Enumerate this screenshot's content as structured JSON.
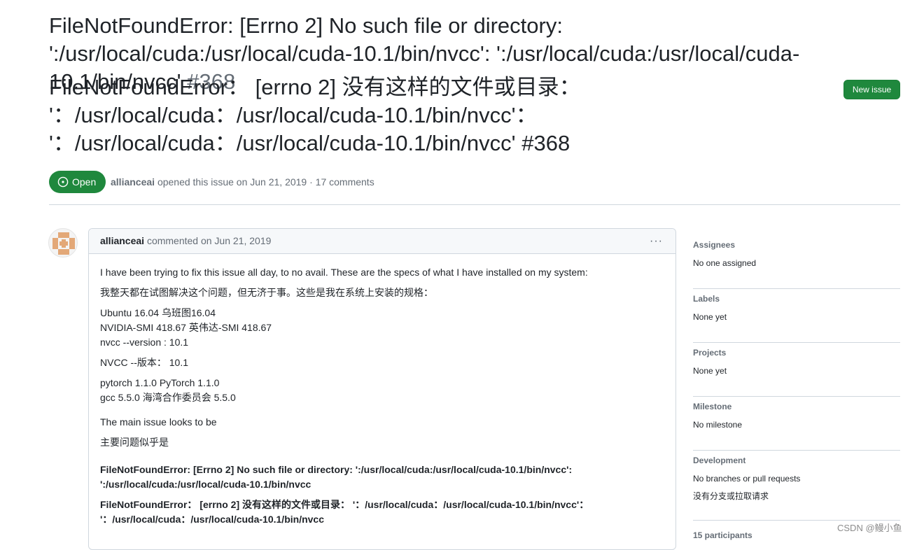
{
  "issue": {
    "title_en": "FileNotFoundError: [Errno 2] No such file or directory: ':/usr/local/cuda:/usr/local/cuda-10.1/bin/nvcc': ':/usr/local/cuda:/usr/local/cuda-10.1/bin/nvcc'",
    "title_zh": "FileNotFoundError： [errno 2] 没有这样的文件或目录： '：/usr/local/cuda：/usr/local/cuda-10.1/bin/nvcc'： '：/usr/local/cuda：/usr/local/cuda-10.1/bin/nvcc'",
    "number_en": "#368",
    "number_zh": "#368",
    "new_issue_label": "New issue",
    "state_label": "Open",
    "author": "allianceai",
    "meta_text": "opened this issue on Jun 21, 2019 · 17 comments"
  },
  "comment": {
    "author": "allianceai",
    "meta": "commented on Jun 21, 2019",
    "menu_label": "···",
    "lines": {
      "l1": "I have been trying to fix this issue all day, to no avail. These are the specs of what I have installed on my system:",
      "l2": "我整天都在试图解决这个问题，但无济于事。这些是我在系统上安装的规格：",
      "l3": "Ubuntu 16.04 乌班图16.04",
      "l4": "NVIDIA-SMI 418.67 英伟达-SMI 418.67",
      "l5": "nvcc --version : 10.1",
      "l6": "NVCC --版本： 10.1",
      "l7": "pytorch 1.1.0 PyTorch 1.1.0",
      "l8": "gcc 5.5.0 海湾合作委员会 5.5.0",
      "l9": "The main issue looks to be",
      "l10": "主要问题似乎是",
      "l11": "FileNotFoundError: [Errno 2] No such file or directory: ':/usr/local/cuda:/usr/local/cuda-10.1/bin/nvcc': ':/usr/local/cuda:/usr/local/cuda-10.1/bin/nvcc",
      "l12": "FileNotFoundError： [errno 2] 没有这样的文件或目录： '：/usr/local/cuda：/usr/local/cuda-10.1/bin/nvcc'： '：/usr/local/cuda：/usr/local/cuda-10.1/bin/nvcc"
    }
  },
  "sidebar": {
    "assignees": {
      "title": "Assignees",
      "value": "No one assigned"
    },
    "labels": {
      "title": "Labels",
      "value": "None yet"
    },
    "projects": {
      "title": "Projects",
      "value": "None yet"
    },
    "milestone": {
      "title": "Milestone",
      "value": "No milestone"
    },
    "development": {
      "title": "Development",
      "value": "No branches or pull requests",
      "value_zh": "没有分支或拉取请求"
    },
    "participants": {
      "title": "15 participants"
    }
  },
  "watermark": "CSDN @鳗小鱼",
  "colors": {
    "open_green": "#1f883d",
    "muted": "#656d76",
    "border": "#d0d7de"
  }
}
